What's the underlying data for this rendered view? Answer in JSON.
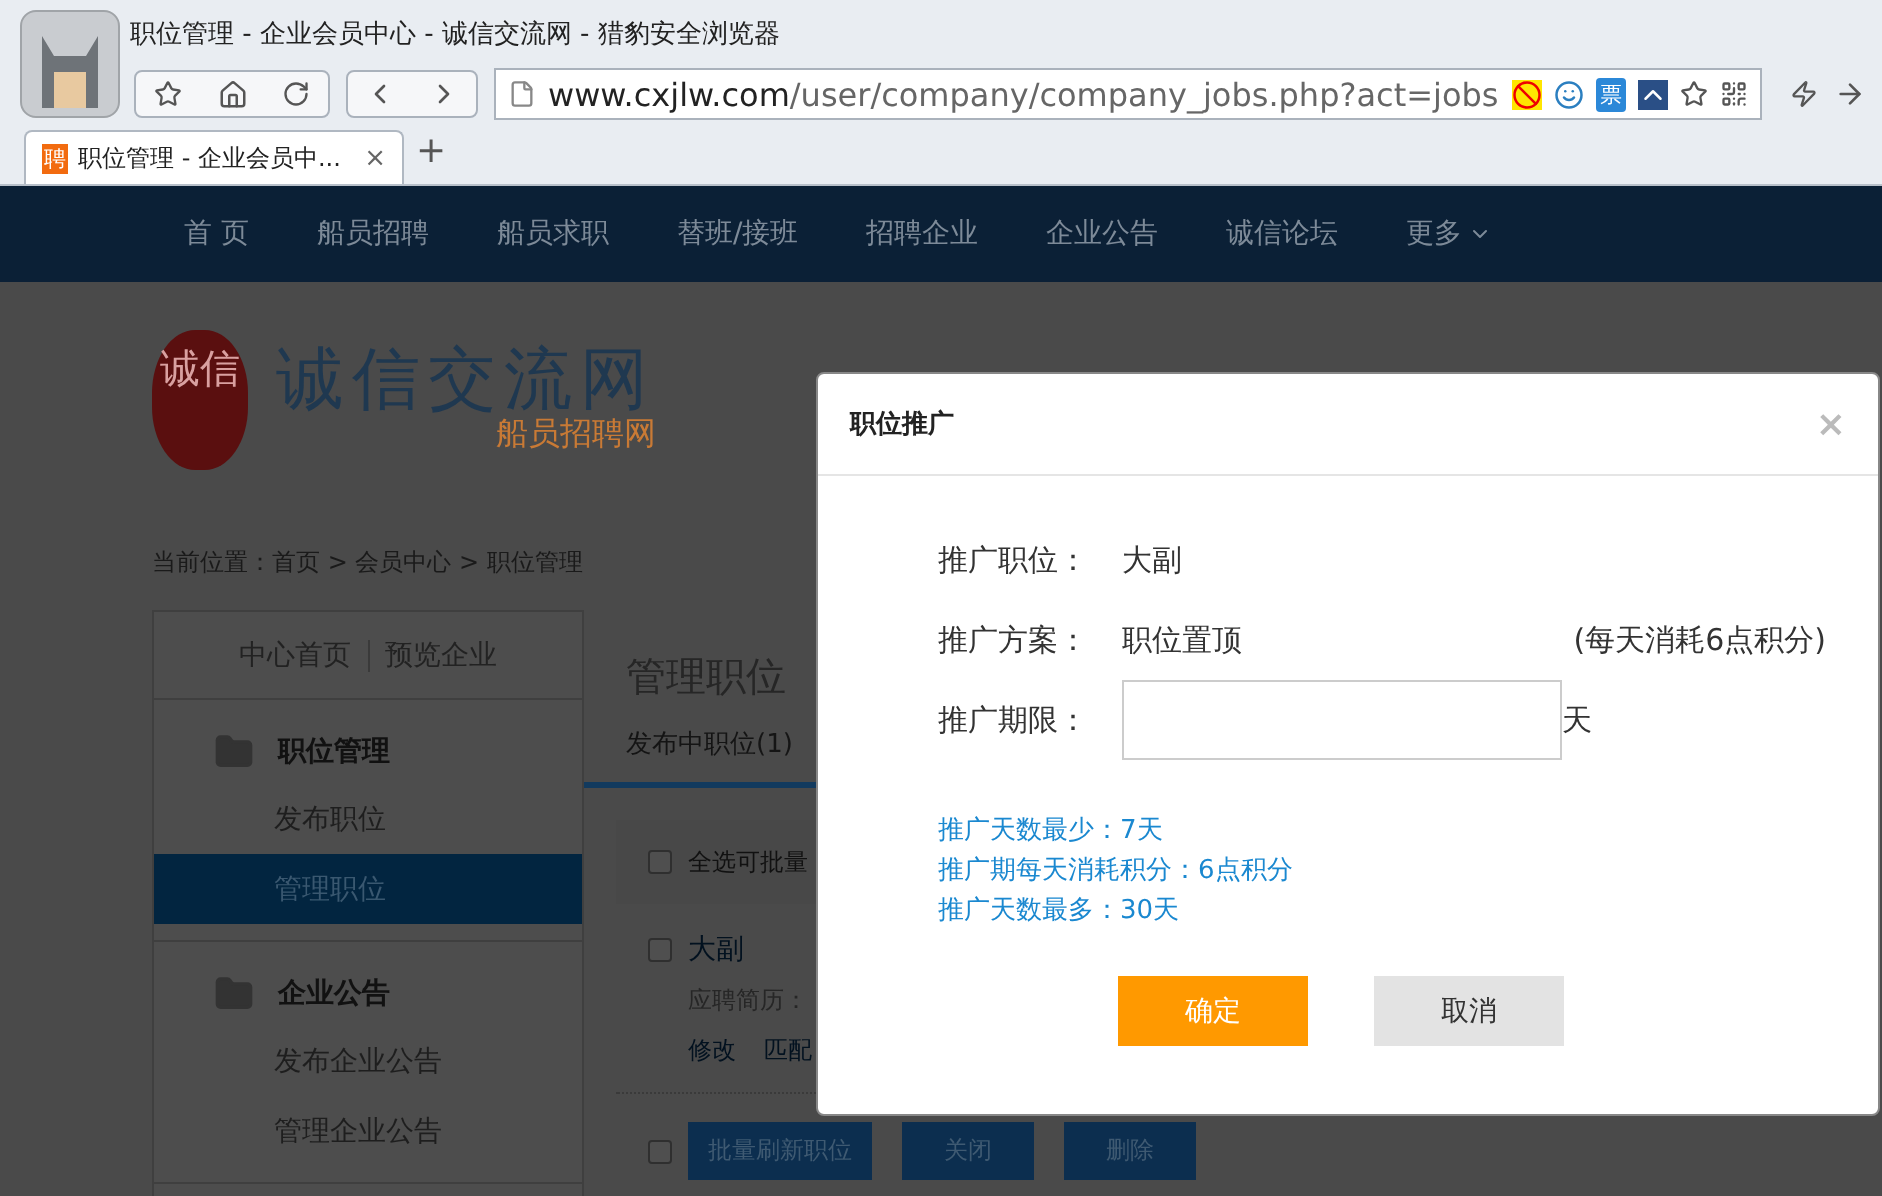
{
  "browser": {
    "title": "职位管理 - 企业会员中心 - 诚信交流网 - 猎豹安全浏览器",
    "address": {
      "domain": "www.cxjlw.com",
      "path": "/user/company/company_jobs.php?act=jobs"
    },
    "ticket_badge": "票",
    "tabs": [
      {
        "favicon": "聘",
        "title": "职位管理 - 企业会员中...",
        "close": "×",
        "selected": true
      }
    ],
    "new_tab": "+"
  },
  "nav": {
    "items": [
      {
        "label": "首 页",
        "dropdown": false
      },
      {
        "label": "船员招聘",
        "dropdown": false
      },
      {
        "label": "船员求职",
        "dropdown": false
      },
      {
        "label": "替班/接班",
        "dropdown": false
      },
      {
        "label": "招聘企业",
        "dropdown": false
      },
      {
        "label": "企业公告",
        "dropdown": false
      },
      {
        "label": "诚信论坛",
        "dropdown": false
      },
      {
        "label": "更多",
        "dropdown": true
      }
    ]
  },
  "site": {
    "seal": "诚信",
    "logo_title": "诚信交流网",
    "logo_subtitle": "船员招聘网",
    "breadcrumb": "当前位置：首页 > 会员中心 > 职位管理"
  },
  "sidebar": {
    "links": [
      "中心首页",
      "预览企业"
    ],
    "sections": [
      {
        "title": "职位管理",
        "items": [
          {
            "label": "发布职位",
            "selected": false
          },
          {
            "label": "管理职位",
            "selected": true
          }
        ]
      },
      {
        "title": "企业公告",
        "items": [
          {
            "label": "发布企业公告",
            "selected": false
          },
          {
            "label": "管理企业公告",
            "selected": false
          }
        ]
      }
    ]
  },
  "main": {
    "heading": "管理职位",
    "tabs": [
      {
        "label": "发布中职位",
        "count": "(1)",
        "selected": true
      }
    ],
    "select_all": {
      "label": "全选可批量",
      "checked": false
    },
    "jobs": [
      {
        "title": "大副",
        "checked": false,
        "resume_label": "应聘简历：",
        "actions": [
          "修改",
          "匹配"
        ]
      }
    ],
    "bulk": {
      "checked": false,
      "actions": [
        "批量刷新职位",
        "关闭",
        "删除"
      ]
    }
  },
  "dialog": {
    "title": "职位推广",
    "close": "×",
    "fields": [
      {
        "kind": "text",
        "label": "推广职位：",
        "value": "大副"
      },
      {
        "kind": "text",
        "label": "推广方案：",
        "value": "职位置顶",
        "note": "(每天消耗6点积分)"
      },
      {
        "kind": "input",
        "label": "推广期限：",
        "unit": "天"
      }
    ],
    "hints": [
      "推广天数最少：7天",
      "推广期每天消耗积分：6点积分",
      "推广天数最多：30天"
    ],
    "buttons": [
      {
        "label": "确定",
        "kind": "primary"
      },
      {
        "label": "取消",
        "kind": "secondary"
      }
    ]
  }
}
